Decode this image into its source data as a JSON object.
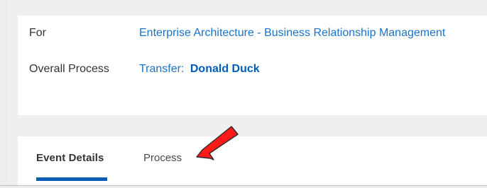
{
  "header": {
    "for_label": "For",
    "for_value": "Enterprise Architecture - Business Relationship Management",
    "overall_process_label": "Overall Process",
    "overall_process_prefix": "Transfer:",
    "overall_process_name": "Donald Duck"
  },
  "tabs": [
    {
      "label": "Event Details",
      "selected": true
    },
    {
      "label": "Process",
      "selected": false
    }
  ],
  "annotation": {
    "icon": "red-arrow-icon",
    "color": "#ff1a1a"
  }
}
